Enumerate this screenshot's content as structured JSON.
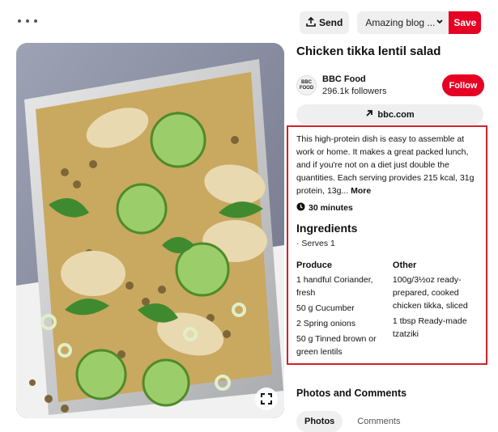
{
  "toolbar": {
    "more_icon": "more-dots-icon",
    "send_label": "Send",
    "board_value": "Amazing blog ...",
    "save_label": "Save"
  },
  "pin": {
    "title": "Chicken tikka lentil salad",
    "image_alt": "Chicken tikka lentil salad in a metal lunch tin"
  },
  "author": {
    "avatar_line1": "BBC",
    "avatar_line2": "FOOD",
    "name": "BBC Food",
    "followers": "296.1k followers",
    "follow_label": "Follow"
  },
  "source": {
    "label": "bbc.com"
  },
  "recipe": {
    "description": "This high-protein dish is easy to assemble at work or home. It makes a great packed lunch, and if you're not on a diet just double the quantities. Each serving provides 215 kcal, 31g protein, 13g...",
    "more_label": "More",
    "duration": "30 minutes",
    "ingredients_title": "Ingredients",
    "serves": "· Serves 1",
    "produce_title": "Produce",
    "produce": [
      "1 handful Coriander, fresh",
      "50 g Cucumber",
      "2 Spring onions",
      "50 g Tinned brown or green lentils"
    ],
    "other_title": "Other",
    "other": [
      "100g/3½oz ready-prepared, cooked chicken tikka, sliced",
      "1 tbsp Ready-made tzatziki"
    ]
  },
  "comments": {
    "heading": "Photos and Comments",
    "tabs": [
      "Photos",
      "Comments"
    ]
  },
  "colors": {
    "brand_red": "#e60023",
    "highlight_border": "#d0212e",
    "button_gray": "#efefef"
  }
}
